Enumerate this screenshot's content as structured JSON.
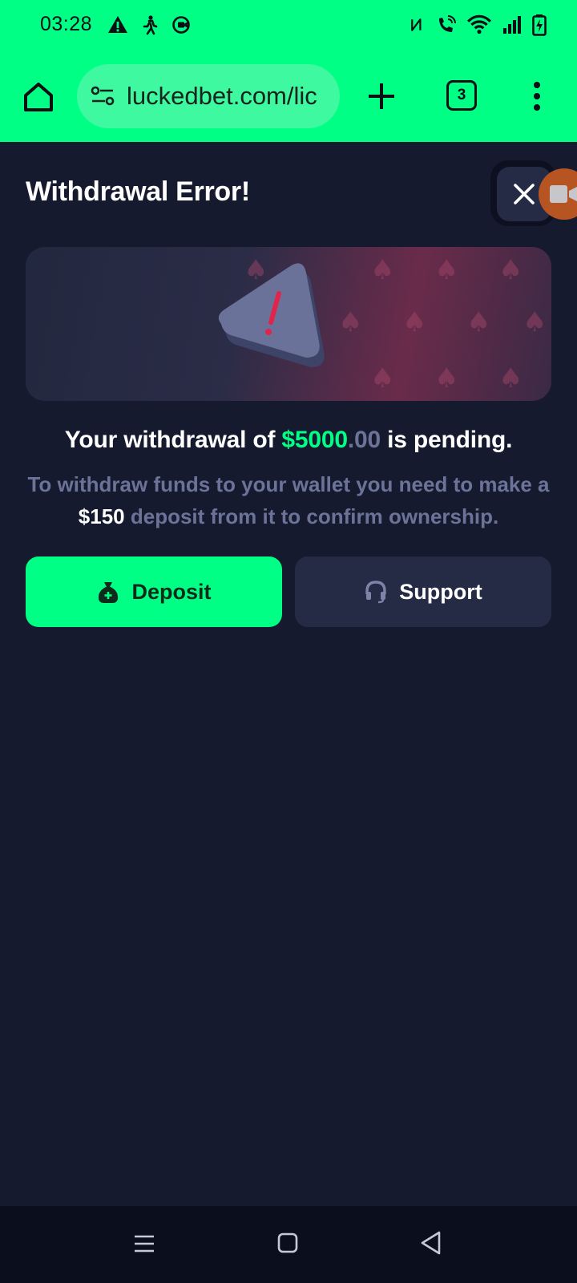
{
  "status_bar": {
    "time": "03:28",
    "left_icons": [
      "alert-icon",
      "walking-icon",
      "screen-record-icon"
    ],
    "right_icons": [
      "nfc-icon",
      "wifi-call-icon",
      "wifi-icon",
      "signal-icon",
      "battery-charging-icon"
    ]
  },
  "browser": {
    "url": "luckedbet.com/lic",
    "tab_count": "3",
    "accent_color": "#00ff85"
  },
  "modal": {
    "title": "Withdrawal Error!",
    "pending_prefix": "Your withdrawal of ",
    "pending_amount_main": "$5000",
    "pending_amount_cents": ".00",
    "pending_suffix": " is pending.",
    "info_prefix": "To withdraw funds to your wallet you need to make a ",
    "info_amount": "$150",
    "info_suffix": " deposit from it to confirm ownership.",
    "deposit_label": "Deposit",
    "support_label": "Support"
  },
  "colors": {
    "background": "#161a2e",
    "primary_green": "#00ff85",
    "muted_text": "#6c7398",
    "secondary_button": "#252a45"
  }
}
